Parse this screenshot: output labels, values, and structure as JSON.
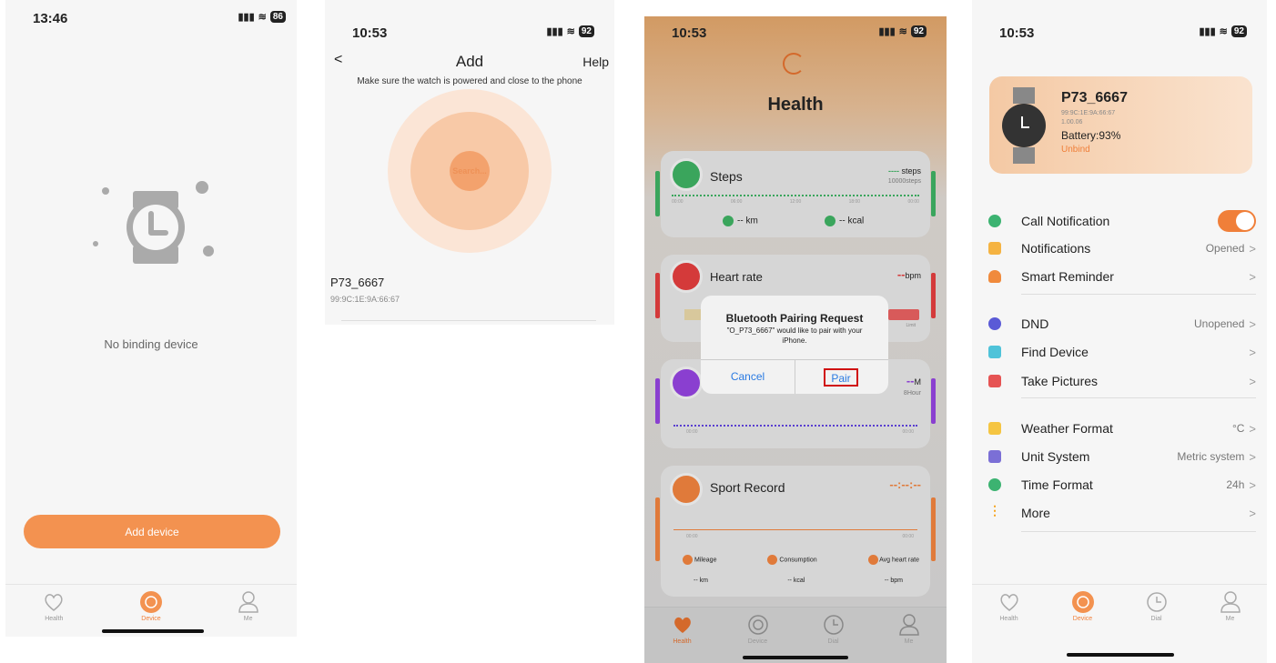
{
  "screen1": {
    "time": "13:46",
    "battery": "86",
    "message": "No binding device",
    "add_button": "Add device",
    "tabs": [
      "Health",
      "Device",
      "Me"
    ]
  },
  "screen2": {
    "time": "10:53",
    "battery": "92",
    "back": "<",
    "title": "Add",
    "help": "Help",
    "instruction": "Make sure the watch is powered and close to the phone",
    "searching": "Search...",
    "device_name": "P73_6667",
    "device_mac": "99:9C:1E:9A:66:67"
  },
  "screen3": {
    "time": "10:53",
    "battery": "92",
    "title": "Health",
    "steps": {
      "label": "Steps",
      "value": "----",
      "unit": "steps",
      "goal": "10000steps",
      "km": "-- km",
      "kcal": "-- kcal",
      "ticks": [
        "00:00",
        "06:00",
        "12:00",
        "18:00",
        "00:00"
      ]
    },
    "heart": {
      "label": "Heart rate",
      "value": "--",
      "unit": "bpm",
      "limit": "Limit"
    },
    "sleep": {
      "value": "--",
      "unit": "M",
      "goal": "8Hour",
      "t0": "00:00",
      "t1": "00:00"
    },
    "sport": {
      "label": "Sport Record",
      "value": "--:--:--",
      "t0": "00:00",
      "t1": "00:00",
      "metrics": [
        "Mileage",
        "Consumption",
        "Avg heart rate"
      ],
      "values": [
        "-- km",
        "-- kcal",
        "-- bpm"
      ]
    },
    "dialog": {
      "title": "Bluetooth Pairing Request",
      "body": "\"O_P73_6667\" would like to pair with your iPhone.",
      "cancel": "Cancel",
      "pair": "Pair"
    },
    "tabs": [
      "Health",
      "Device",
      "Dial",
      "Me"
    ]
  },
  "screen4": {
    "time": "10:53",
    "battery": "92",
    "device_name": "P73_6667",
    "device_mac": "99:9C:1E:9A:66:67",
    "firmware": "1.00.06",
    "battery_text": "Battery:93%",
    "unbind": "Unbind",
    "rows": [
      {
        "label": "Call Notification",
        "value": "",
        "color": "#3cb371"
      },
      {
        "label": "Notifications",
        "value": "Opened",
        "color": "#f5b342"
      },
      {
        "label": "Smart Reminder",
        "value": "",
        "color": "#f08a3c"
      },
      {
        "label": "DND",
        "value": "Unopened",
        "color": "#5a5ad6"
      },
      {
        "label": "Find Device",
        "value": "",
        "color": "#4fc3d9"
      },
      {
        "label": "Take Pictures",
        "value": "",
        "color": "#e65454"
      },
      {
        "label": "Weather Format",
        "value": "°C",
        "color": "#f5c542"
      },
      {
        "label": "Unit System",
        "value": "Metric system",
        "color": "#7b6fd6"
      },
      {
        "label": "Time Format",
        "value": "24h",
        "color": "#3cb371"
      },
      {
        "label": "More",
        "value": "",
        "color": "#f5a623"
      }
    ],
    "tabs": [
      "Health",
      "Device",
      "Dial",
      "Me"
    ]
  },
  "colors": {
    "accent": "#f07f39"
  }
}
